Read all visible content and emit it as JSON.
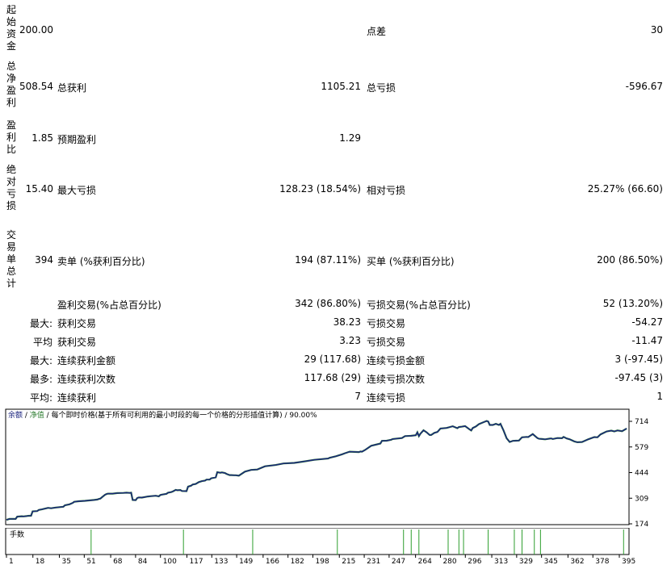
{
  "report": {
    "rows": [
      {
        "label": "起始资金",
        "value": "200.00",
        "c1": "",
        "v1": "",
        "c2": "点差",
        "v2": "30"
      },
      {
        "label": "总净盈利",
        "value": "508.54",
        "c1": "总获利",
        "v1": "1105.21",
        "c2": "总亏损",
        "v2": "-596.67"
      },
      {
        "label": "盈利比",
        "value": "1.85",
        "c1": "预期盈利",
        "v1": "1.29",
        "c2": "",
        "v2": ""
      },
      {
        "label": "绝对亏损",
        "value": "15.40",
        "c1": "最大亏损",
        "v1": "128.23 (18.54%)",
        "c2": "相对亏损",
        "v2": "25.27% (66.60)"
      },
      {
        "label": "交易单总计",
        "value": "394",
        "c1": "卖单 (%获利百分比)",
        "v1": "194 (87.11%)",
        "c2": "买单 (%获利百分比)",
        "v2": "200 (86.50%)"
      }
    ],
    "stats": [
      {
        "pre": "",
        "c1": "盈利交易(%占总百分比)",
        "v1": "342 (86.80%)",
        "c2": "亏损交易(%占总百分比)",
        "v2": "52 (13.20%)"
      },
      {
        "pre": "最大:",
        "c1": "获利交易",
        "v1": "38.23",
        "c2": "亏损交易",
        "v2": "-54.27"
      },
      {
        "pre": "平均",
        "c1": "获利交易",
        "v1": "3.23",
        "c2": "亏损交易",
        "v2": "-11.47"
      },
      {
        "pre": "最大:",
        "c1": "连续获利金额",
        "v1": "29 (117.68)",
        "c2": "连续亏损金额",
        "v2": "3 (-97.45)"
      },
      {
        "pre": "最多:",
        "c1": "连续获利次数",
        "v1": "117.68 (29)",
        "c2": "连续亏损次数",
        "v2": "-97.45 (3)"
      },
      {
        "pre": "平均:",
        "c1": "连续获利",
        "v1": "7",
        "c2": "连续亏损",
        "v2": "1"
      }
    ]
  },
  "chart_data": {
    "type": "line",
    "legend": {
      "balance": "余额",
      "sep1": " / ",
      "equity": "净值",
      "sep2": " / ",
      "rest": "每个即时价格(基于所有可利用的最小时段的每一个价格的分形插值计算) / 90.00%"
    },
    "colors": {
      "balance": "#1a237e",
      "equity": "#2e7d32",
      "volume": "#2e9e2e"
    },
    "ylim": [
      174,
      735
    ],
    "yticks": [
      714,
      579,
      444,
      309,
      174
    ],
    "xlim": [
      0,
      404
    ],
    "xticks": [
      1,
      18,
      35,
      51,
      68,
      84,
      100,
      117,
      133,
      149,
      166,
      182,
      198,
      215,
      231,
      247,
      264,
      280,
      296,
      313,
      329,
      345,
      362,
      378,
      395
    ],
    "series": [
      {
        "name": "余额",
        "x": [
          0,
          2,
          6,
          7,
          10,
          11,
          13,
          14,
          16,
          17,
          20,
          21,
          23,
          26,
          27,
          29,
          32,
          37,
          38,
          41,
          43,
          44,
          47,
          51,
          57,
          59,
          60,
          61,
          62,
          64,
          65,
          66,
          69,
          72,
          76,
          78,
          80,
          81,
          82,
          84,
          85,
          86,
          88,
          92,
          94,
          97,
          99,
          100,
          101,
          104,
          105,
          107,
          108,
          110,
          111,
          113,
          114,
          117,
          118,
          120,
          121,
          123,
          125,
          127,
          129,
          130,
          132,
          133,
          136,
          137,
          139,
          140,
          142,
          143,
          145,
          146,
          148,
          149,
          151,
          155,
          159,
          163,
          168,
          175,
          180,
          187,
          192,
          200,
          209,
          210,
          214,
          218,
          220,
          223,
          229,
          230,
          231,
          233,
          237,
          243,
          244,
          247,
          250,
          251,
          257,
          259,
          263,
          266,
          267,
          268,
          269,
          271,
          273,
          275,
          276,
          278,
          280,
          282,
          286,
          290,
          293,
          294,
          296,
          298,
          301,
          302,
          303,
          305,
          307,
          309,
          312,
          313,
          314,
          316,
          318,
          320,
          321,
          323,
          325,
          327,
          329,
          331,
          333,
          335,
          338,
          339,
          342,
          345,
          346,
          348,
          350,
          353,
          354,
          355,
          358,
          361,
          362,
          364,
          366,
          369,
          371,
          374,
          378,
          382,
          384,
          386,
          390,
          393,
          395,
          397,
          400,
          403
        ],
        "y": [
          195,
          200,
          200,
          212,
          214,
          213,
          215,
          216,
          217,
          240,
          241,
          247,
          250,
          256,
          258,
          256,
          260,
          264,
          272,
          277,
          284,
          290,
          293,
          295,
          300,
          302,
          305,
          307,
          314,
          327,
          331,
          333,
          333,
          336,
          337,
          338,
          337,
          338,
          300,
          299,
          310,
          313,
          312,
          318,
          320,
          322,
          319,
          326,
          328,
          332,
          338,
          341,
          344,
          353,
          351,
          352,
          347,
          346,
          370,
          375,
          381,
          384,
          394,
          399,
          402,
          407,
          407,
          414,
          419,
          446,
          443,
          445,
          442,
          437,
          431,
          431,
          430,
          430,
          428,
          449,
          458,
          460,
          477,
          484,
          492,
          495,
          501,
          511,
          518,
          522,
          530,
          540,
          546,
          554,
          552,
          555,
          554,
          563,
          585,
          597,
          611,
          612,
          617,
          621,
          626,
          636,
          638,
          641,
          656,
          636,
          649,
          667,
          656,
          642,
          642,
          653,
          658,
          676,
          679,
          688,
          678,
          684,
          686,
          689,
          671,
          666,
          679,
          687,
          699,
          706,
          716,
          713,
          695,
          695,
          701,
          695,
          701,
          666,
          625,
          605,
          611,
          612,
          613,
          630,
          632,
          631,
          647,
          626,
          622,
          621,
          619,
          623,
          624,
          621,
          626,
          625,
          632,
          624,
          619,
          608,
          604,
          605,
          619,
          631,
          630,
          645,
          661,
          665,
          661,
          666,
          662,
          676
        ],
        "ylim_note": "balance curve"
      }
    ],
    "volume": {
      "name": "手数",
      "x": [
        55,
        115,
        160,
        215,
        258,
        263,
        268,
        287,
        294,
        297,
        313,
        330,
        335,
        343,
        347,
        401
      ],
      "h": [
        1,
        1,
        1,
        1,
        1,
        1,
        1,
        1,
        1,
        1,
        1,
        1,
        1,
        1,
        1,
        1
      ]
    }
  }
}
